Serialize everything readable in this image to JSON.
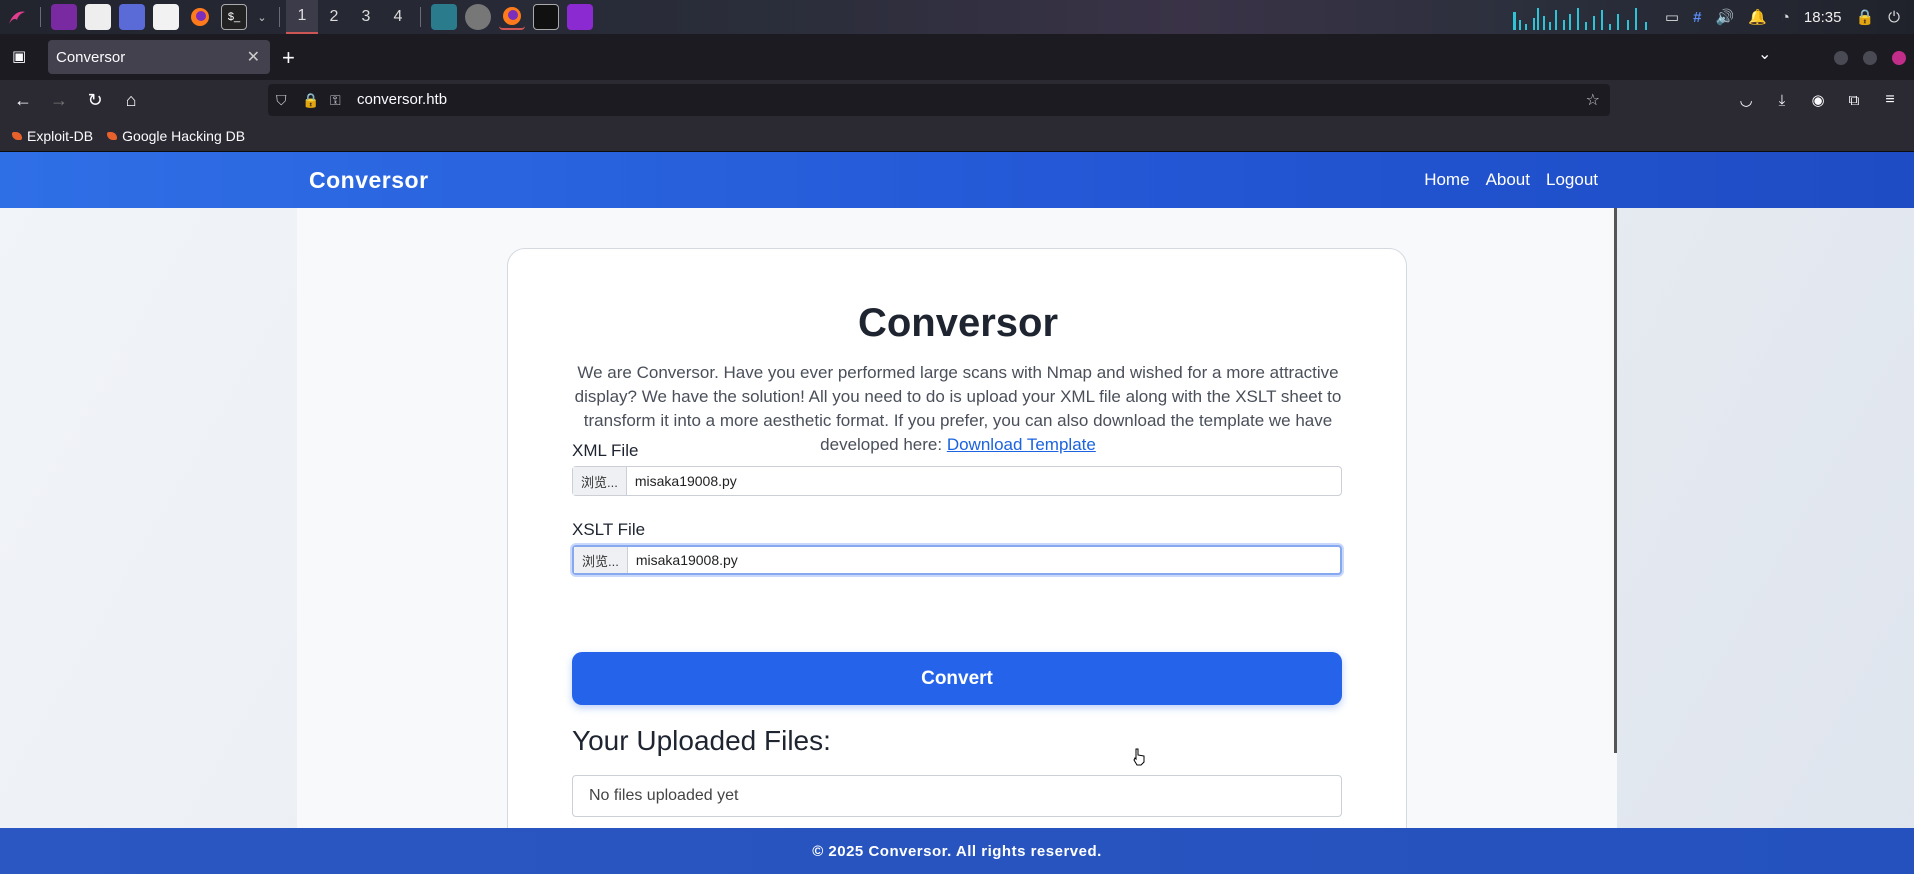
{
  "taskbar": {
    "workspaces": [
      "1",
      "2",
      "3",
      "4"
    ],
    "clock": "18:35"
  },
  "browser": {
    "tab_title": "Conversor",
    "url": "conversor.htb",
    "bookmarks": [
      "Exploit-DB",
      "Google Hacking DB"
    ]
  },
  "site": {
    "brand": "Conversor",
    "nav": [
      "Home",
      "About",
      "Logout"
    ],
    "title": "Conversor",
    "intro": "We are Conversor. Have you ever performed large scans with Nmap and wished for a more attractive display? We have the solution! All you need to do is upload your XML file along with the XSLT sheet to transform it into a more aesthetic format. If you prefer, you can also download the template we have developed here:",
    "download_link": "Download Template",
    "xml_label": "XML File",
    "xslt_label": "XSLT File",
    "browse_label": "浏览...",
    "xml_file": "misaka19008.py",
    "xslt_file": "misaka19008.py",
    "convert_label": "Convert",
    "uploaded_title": "Your Uploaded Files:",
    "no_files": "No files uploaded yet",
    "footer": "© 2025 Conversor. All rights reserved."
  },
  "colors": {
    "accent": "#2563eb",
    "nav_bg": "#2458d6",
    "footer_bg": "#2451bd"
  }
}
